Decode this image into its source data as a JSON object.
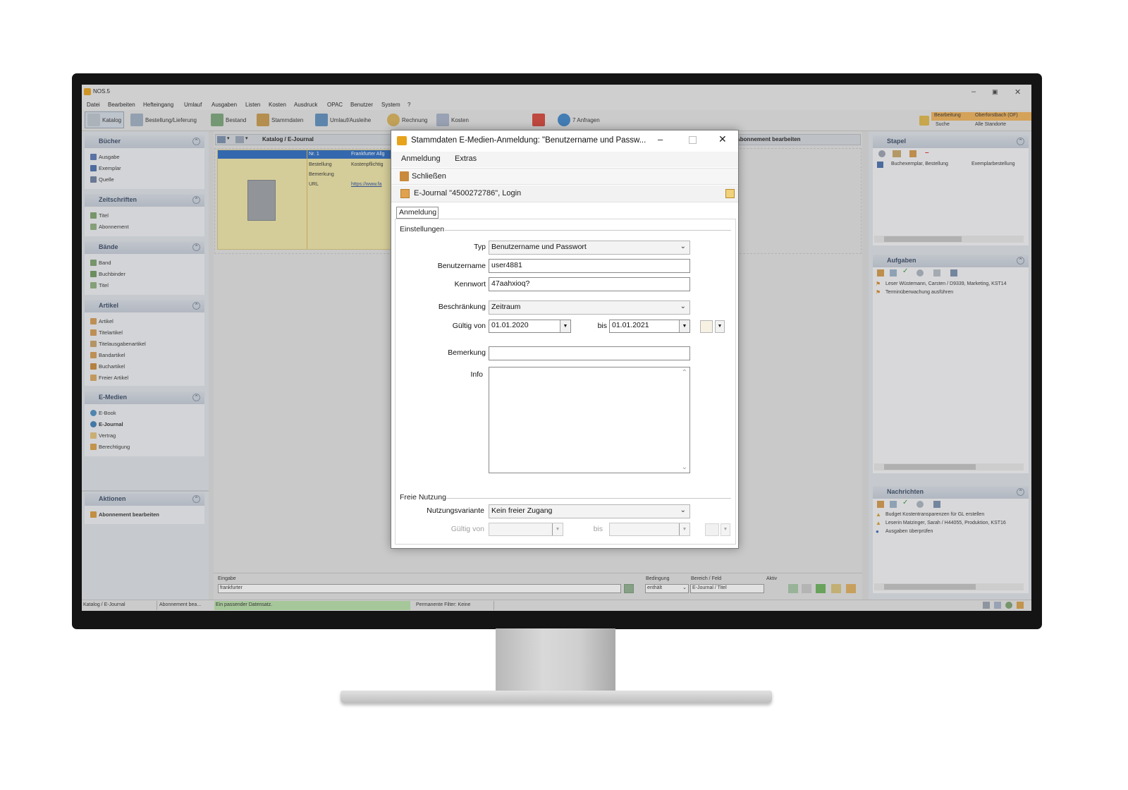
{
  "app": {
    "title": "NOS.5",
    "menu": [
      "Datei",
      "Bearbeiten",
      "Hefteingang",
      "Umlauf",
      "Ausgaben",
      "Listen",
      "Kosten",
      "Ausdruck",
      "OPAC",
      "Benutzer",
      "System",
      "?"
    ],
    "toolbar": [
      "Katalog",
      "Bestellung/Lieferung",
      "Bestand",
      "Stammdaten",
      "Umlauf/Ausleihe",
      "Rechnung",
      "Kosten",
      "7 Anfragen"
    ],
    "location": {
      "bearbeitung_label": "Bearbeitung",
      "bearbeitung_value": "Oberforstbach (OF)",
      "suche_label": "Suche",
      "suche_value": "Alle Standorte"
    }
  },
  "sidebar": {
    "sections": [
      {
        "title": "Bücher",
        "items": [
          "Ausgabe",
          "Exemplar",
          "Quelle"
        ]
      },
      {
        "title": "Zeitschriften",
        "items": [
          "Titel",
          "Abonnement"
        ]
      },
      {
        "title": "Bände",
        "items": [
          "Band",
          "Buchbinder",
          "Titel"
        ]
      },
      {
        "title": "Artikel",
        "items": [
          "Artikel",
          "Titelartikel",
          "Titelausgabenartikel",
          "Bandartikel",
          "Buchartikel",
          "Freier Artikel"
        ]
      },
      {
        "title": "E-Medien",
        "items": [
          "E-Book",
          "E-Journal",
          "Vertrag",
          "Berechtigung"
        ]
      }
    ],
    "aktionen": {
      "title": "Aktionen",
      "items": [
        "Abonnement bearbeiten"
      ]
    }
  },
  "main": {
    "breadcrumb": "Katalog / E-Journal",
    "right_header": "Abonnement bearbeiten",
    "record": {
      "rows": [
        {
          "label": "Nr. 1",
          "value": "Frankfurter Allg"
        },
        {
          "label": "Bestellung",
          "value": "Kostenpflichtig"
        },
        {
          "label": "Bemerkung",
          "value": ""
        },
        {
          "label": "URL",
          "value": "https://www.fa"
        }
      ]
    },
    "search": {
      "eingabe_label": "Eingabe",
      "eingabe_value": "frankfurter",
      "bedingung_label": "Bedingung",
      "bedingung_value": "enthält",
      "bereich_label": "Bereich / Feld",
      "bereich_value": "E-Journal / Titel",
      "aktiv_label": "Aktiv"
    }
  },
  "right_panels": {
    "stapel": {
      "title": "Stapel",
      "row_col1": "Buchexemplar, Bestellung",
      "row_col2": "Exemplarbestellung"
    },
    "aufgaben": {
      "title": "Aufgaben",
      "items": [
        "Leser Wüstemann, Carsten / D9339, Marketing, KST14",
        "Terminüberwachung ausführen"
      ]
    },
    "nachrichten": {
      "title": "Nachrichten",
      "items": [
        "Budget Kostentransparenzen für GL erstellen",
        "Leserin Matzinger, Sarah / H44055, Produktion, KST16",
        "Ausgaben überprüfen"
      ]
    }
  },
  "statusbar": {
    "segments": [
      "Katalog / E-Journal",
      "Abonnement bea...",
      "Ein passender Datensatz.",
      "Permanente Filter: Keine"
    ]
  },
  "dialog": {
    "title": "Stammdaten E-Medien-Anmeldung: \"Benutzername und Passw...",
    "menu": [
      "Anmeldung",
      "Extras"
    ],
    "close_label": "Schließen",
    "record_title": "E-Journal \"4500272786\", Login",
    "tab": "Anmeldung",
    "einstellungen_label": "Einstellungen",
    "fields": {
      "typ_label": "Typ",
      "typ_value": "Benutzername und Passwort",
      "benutzername_label": "Benutzername",
      "benutzername_value": "user4881",
      "kennwort_label": "Kennwort",
      "kennwort_value": "47aahxioq?",
      "beschraenkung_label": "Beschränkung",
      "beschraenkung_value": "Zeitraum",
      "gueltig_von_label": "Gültig von",
      "gueltig_von_value": "01.01.2020",
      "bis_label": "bis",
      "bis_value": "01.01.2021",
      "bemerkung_label": "Bemerkung",
      "bemerkung_value": "",
      "info_label": "Info",
      "info_value": ""
    },
    "freie_nutzung_label": "Freie Nutzung",
    "freie_nutzung": {
      "nutzungsvariante_label": "Nutzungsvariante",
      "nutzungsvariante_value": "Kein freier Zugang",
      "gueltig_von_label": "Gültig von",
      "bis_label": "bis"
    }
  },
  "colors": {
    "selection": "#2b6cc2",
    "record_bg": "#f7efb8",
    "status_green": "#b8e0a8",
    "panel_header": "#c9d2de"
  }
}
